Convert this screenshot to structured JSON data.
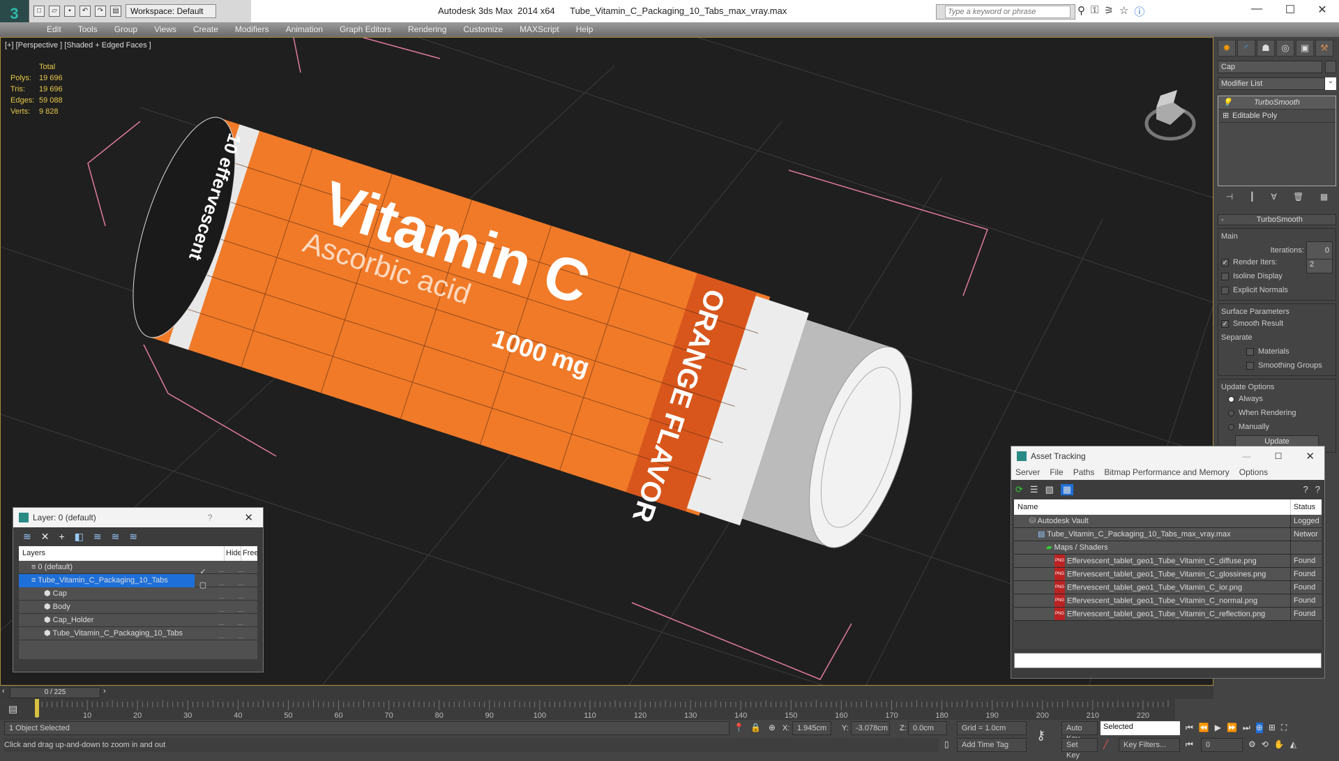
{
  "titlebar": {
    "workspace": "Workspace: Default",
    "app": "Autodesk 3ds Max  2014 x64",
    "file": "Tube_Vitamin_C_Packaging_10_Tabs_max_vray.max",
    "search_placeholder": "Type a keyword or phrase"
  },
  "menu": [
    "Edit",
    "Tools",
    "Group",
    "Views",
    "Create",
    "Modifiers",
    "Animation",
    "Graph Editors",
    "Rendering",
    "Customize",
    "MAXScript",
    "Help"
  ],
  "viewport": {
    "label": "[+] [Perspective ] [Shaded + Edged Faces ]",
    "stats": {
      "header": "Total",
      "rows": [
        {
          "k": "Polys:",
          "v": "19 696"
        },
        {
          "k": "Tris:",
          "v": "19 696"
        },
        {
          "k": "Edges:",
          "v": "59 088"
        },
        {
          "k": "Verts:",
          "v": "9 828"
        }
      ]
    },
    "model_text": {
      "title": "Vitamin C",
      "subtitle": "Ascorbic acid",
      "dose": "1000 mg",
      "flavor": "ORANGE FLAVOR",
      "side": "10 effervescent"
    }
  },
  "command_panel": {
    "object_name": "Cap",
    "modifier_list": "Modifier List",
    "stack": [
      "TurboSmooth",
      "Editable Poly"
    ],
    "rollout": "TurboSmooth",
    "main": "Main",
    "iterations_label": "Iterations:",
    "iterations": "0",
    "render_iters_label": "Render Iters:",
    "render_iters": "2",
    "render_iters_checked": true,
    "isoline": "Isoline Display",
    "explicit": "Explicit Normals",
    "surface": "Surface Parameters",
    "smooth_result": "Smooth Result",
    "separate": "Separate",
    "materials": "Materials",
    "smoothing_groups": "Smoothing Groups",
    "update_options": "Update Options",
    "always": "Always",
    "when_rendering": "When Rendering",
    "manually": "Manually",
    "selected_update": "Always",
    "update_button": "Update"
  },
  "layer_dialog": {
    "title": "Layer: 0 (default)",
    "help": "?",
    "col_layers": "Layers",
    "col_hide": "Hide",
    "col_freeze": "Free",
    "rows": [
      {
        "name": "0 (default)",
        "level": 1,
        "current": true
      },
      {
        "name": "Tube_Vitamin_C_Packaging_10_Tabs",
        "level": 1,
        "selected": true
      },
      {
        "name": "Cap",
        "level": 2
      },
      {
        "name": "Body",
        "level": 2
      },
      {
        "name": "Cap_Holder",
        "level": 2
      },
      {
        "name": "Tube_Vitamin_C_Packaging_10_Tabs",
        "level": 2
      }
    ]
  },
  "asset_tracking": {
    "title": "Asset Tracking",
    "menu": [
      "Server",
      "File",
      "Paths",
      "Bitmap Performance and Memory",
      "Options"
    ],
    "col_name": "Name",
    "col_status": "Status",
    "rows": [
      {
        "name": "Autodesk Vault",
        "status": "Logged",
        "level": 1,
        "icon": "vault"
      },
      {
        "name": "Tube_Vitamin_C_Packaging_10_Tabs_max_vray.max",
        "status": "Networ",
        "level": 2,
        "icon": "max"
      },
      {
        "name": "Maps / Shaders",
        "status": "",
        "level": 3,
        "icon": "maps"
      },
      {
        "name": "Effervescent_tablet_geo1_Tube_Vitamin_C_diffuse.png",
        "status": "Found",
        "level": 4,
        "icon": "png"
      },
      {
        "name": "Effervescent_tablet_geo1_Tube_Vitamin_C_glossines.png",
        "status": "Found",
        "level": 4,
        "icon": "png"
      },
      {
        "name": "Effervescent_tablet_geo1_Tube_Vitamin_C_ior.png",
        "status": "Found",
        "level": 4,
        "icon": "png"
      },
      {
        "name": "Effervescent_tablet_geo1_Tube_Vitamin_C_normal.png",
        "status": "Found",
        "level": 4,
        "icon": "png"
      },
      {
        "name": "Effervescent_tablet_geo1_Tube_Vitamin_C_reflection.png",
        "status": "Found",
        "level": 4,
        "icon": "png"
      }
    ]
  },
  "timeline": {
    "frame": "0 / 225",
    "current": 0,
    "total": 225,
    "ticks": [
      0,
      10,
      20,
      30,
      40,
      50,
      60,
      70,
      80,
      90,
      100,
      110,
      120,
      130,
      140,
      150,
      160,
      170,
      180,
      190,
      200,
      210,
      220
    ]
  },
  "status": {
    "selection": "1 Object Selected",
    "prompt": "Click and drag up-and-down to zoom in and out",
    "x": "1.945cm",
    "y": "-3.078cm",
    "z": "0.0cm",
    "x_label": "X:",
    "y_label": "Y:",
    "z_label": "Z:",
    "grid": "Grid = 1.0cm",
    "add_time_tag": "Add Time Tag",
    "auto_key": "Auto Key",
    "set_key": "Set Key",
    "key_mode": "Selected",
    "key_filters": "Key Filters...",
    "frame_field": "0"
  },
  "colors": {
    "accent": "#1e6fd9",
    "orange": "#f07a28",
    "stats": "#e6c94a",
    "frame_border": "#a8903c"
  }
}
